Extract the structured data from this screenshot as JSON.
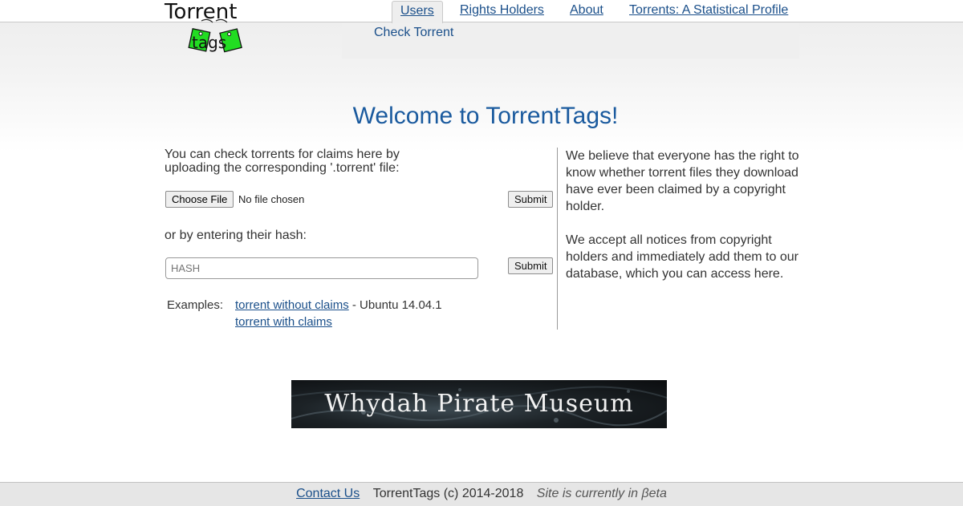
{
  "header": {
    "logo_word": "Torrent",
    "logo_tag_text": "tags",
    "nav": [
      {
        "label": "Users",
        "active": true
      },
      {
        "label": "Rights Holders",
        "active": false
      },
      {
        "label": "About",
        "active": false
      },
      {
        "label": "Torrents: A Statistical Profile",
        "active": false
      }
    ],
    "subnav": {
      "check_torrent": "Check Torrent"
    }
  },
  "main": {
    "title": "Welcome to TorrentTags!",
    "intro": "You can check torrents for claims here by uploading the corresponding '.torrent' file:",
    "choose_file_label": "Choose File",
    "no_file_text": "No file chosen",
    "submit_label": "Submit",
    "or_text": "or by entering their hash:",
    "hash_placeholder": "HASH",
    "examples_label": "Examples:",
    "example_1_link": "torrent without claims",
    "example_1_suffix": " - Ubuntu 14.04.1",
    "example_2_link": "torrent with claims",
    "right_p1": "We believe that everyone has the right to know whether torrent files they download have ever been claimed by a copyright holder.",
    "right_p2": "We accept all notices from copyright holders and immediately add them to our database, which you can access here."
  },
  "banner": {
    "text": "Whydah Pirate Museum"
  },
  "footer": {
    "contact": "Contact Us",
    "copyright": "TorrentTags (c) 2014-2018",
    "beta": "Site is currently in βeta"
  },
  "colors": {
    "link": "#1a4f8a",
    "title": "#1a5a9e",
    "tag_green": "#22dd22"
  }
}
